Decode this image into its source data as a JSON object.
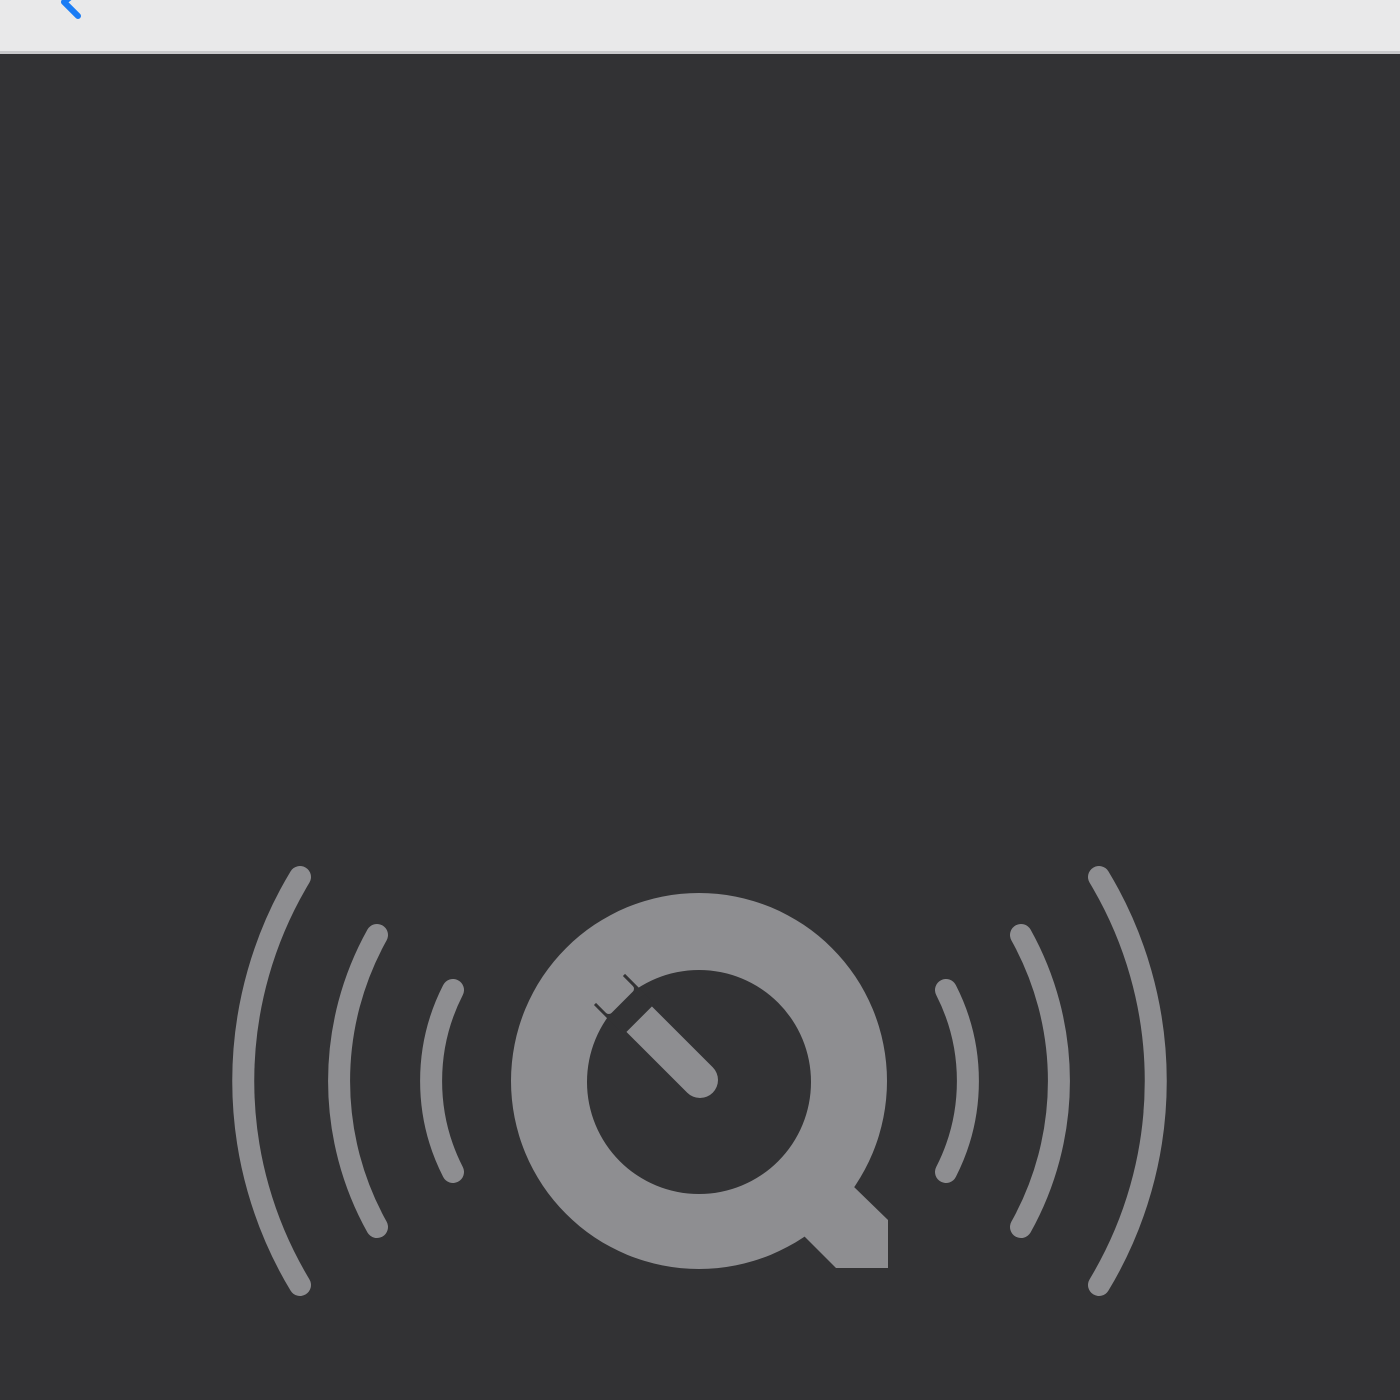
{
  "window": {
    "title": "",
    "back_icon": "chevron-left-icon"
  },
  "content": {
    "logo_icon": "quicktime-broadcast-logo-icon",
    "colors": {
      "background": "#323234",
      "logo": "#8e8e91",
      "title_bar": "#e9e9ea",
      "accent": "#1a7cf5"
    }
  }
}
